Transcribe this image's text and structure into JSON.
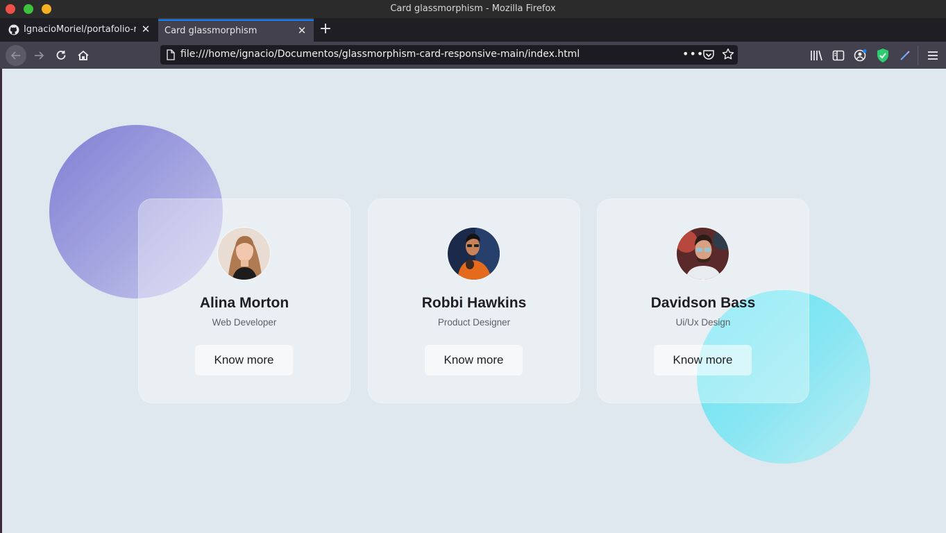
{
  "window": {
    "title": "Card glassmorphism - Mozilla Firefox"
  },
  "tabs": [
    {
      "label": "IgnacioMoriel/portafolio-r",
      "active": false
    },
    {
      "label": "Card glassmorphism",
      "active": true
    }
  ],
  "urlbar": {
    "url": "file:///home/ignacio/Documentos/glassmorphism-card-responsive-main/index.html"
  },
  "colors": {
    "page_bg": "#dfe7ef",
    "blob_purple": "#7f7fd5",
    "blob_cyan": "#5fe3f3",
    "traffic_close": "#ee4f46",
    "traffic_max": "#3cc23c",
    "traffic_min": "#f4b022"
  },
  "cards": [
    {
      "name": "Alina Morton",
      "role": "Web Developer",
      "button": "Know more",
      "avatar": "avatar-woman"
    },
    {
      "name": "Robbi Hawkins",
      "role": "Product Designer",
      "button": "Know more",
      "avatar": "avatar-man-orange-shirt"
    },
    {
      "name": "Davidson Bass",
      "role": "Ui/Ux Design",
      "button": "Know more",
      "avatar": "avatar-man-glasses"
    }
  ]
}
